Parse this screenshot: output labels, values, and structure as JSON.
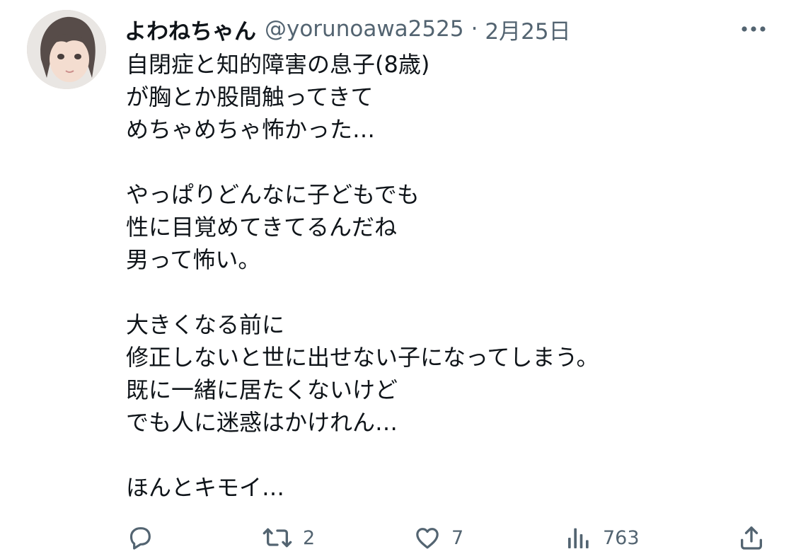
{
  "user": {
    "display_name": "よわねちゃん",
    "handle": "@yorunoawa2525",
    "separator": "·",
    "date": "2月25日"
  },
  "tweet": {
    "lines": [
      "自閉症と知的障害の息子(8歳)",
      "が胸とか股間触ってきて",
      "めちゃめちゃ怖かった…",
      "",
      "やっぱりどんなに子どもでも",
      "性に目覚めてきてるんだね",
      "男って怖い。",
      "",
      "大きくなる前に",
      "修正しないと世に出せない子になってしまう。",
      "既に一緒に居たくないけど",
      "でも人に迷惑はかけれん…",
      "",
      "ほんとキモイ…"
    ]
  },
  "actions": {
    "reply": {
      "icon": "reply-icon",
      "count": ""
    },
    "retweet": {
      "icon": "retweet-icon",
      "count": "2"
    },
    "like": {
      "icon": "heart-icon",
      "count": "7"
    },
    "views": {
      "icon": "views-icon",
      "count": "763"
    },
    "share": {
      "icon": "share-icon",
      "count": ""
    }
  },
  "colors": {
    "text": "#0f1419",
    "secondary": "#536471",
    "background": "#ffffff"
  }
}
